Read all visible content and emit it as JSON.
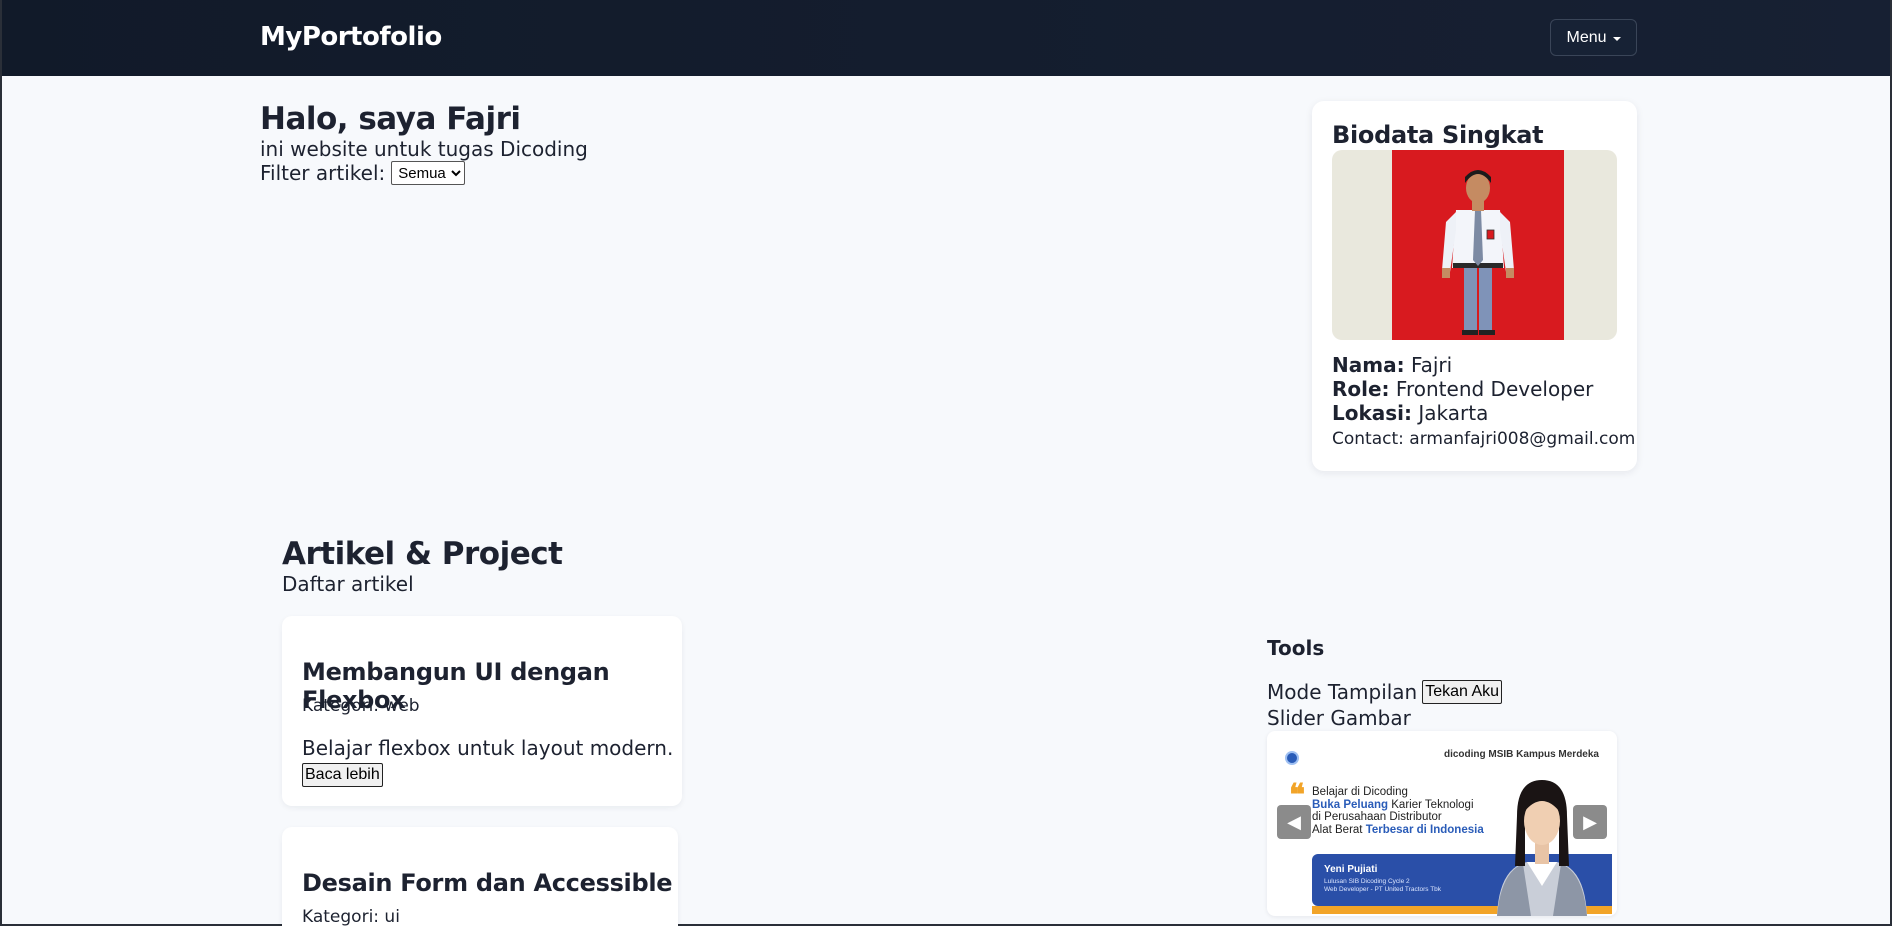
{
  "navbar": {
    "brand": "MyPortofolio",
    "menu_label": "Menu"
  },
  "hero": {
    "title": "Halo, saya Fajri",
    "subtitle": "ini website untuk tugas Dicoding",
    "filter_label": "Filter artikel:",
    "filter_selected": "Semua"
  },
  "biodata": {
    "title": "Biodata Singkat",
    "nama_label": "Nama:",
    "nama_value": "Fajri",
    "role_label": "Role:",
    "role_value": "Frontend Developer",
    "lokasi_label": "Lokasi:",
    "lokasi_value": "Jakarta",
    "contact": "Contact: armanfajri008@gmail.com"
  },
  "articles": {
    "title": "Artikel & Project",
    "subtitle": "Daftar artikel",
    "items": [
      {
        "title": "Membangun UI dengan Flexbox",
        "category": "Kategori: web",
        "description": "Belajar flexbox untuk layout modern.",
        "button": "Baca lebih"
      },
      {
        "title": "Desain Form dan Accessible",
        "category": "Kategori: ui"
      }
    ]
  },
  "tools": {
    "title": "Tools",
    "mode_label": "Mode Tampilan",
    "mode_button": "Tekan Aku",
    "slider_label": "Slider Gambar",
    "slide": {
      "brands": "dicoding  MSIB  Kampus Merdeka",
      "quote_mark": "❝",
      "line1": "Belajar di Dicoding",
      "line2_hl": "Buka Peluang",
      "line2_rest": " Karier Teknologi",
      "line3": "di Perusahaan Distributor",
      "line4_pre": "Alat Berat ",
      "line4_hl": "Terbesar di Indonesia",
      "person_name": "Yeni Pujiati",
      "person_desc1": "Lulusan SIB Dicoding Cycle 2",
      "person_desc2": "Web Developer - PT United Tractors Tbk",
      "prev": "◀",
      "next": "▶"
    }
  },
  "colors": {
    "navbar_bg": "#111a29",
    "page_bg": "#f7f9fc",
    "card_bg": "#ffffff",
    "accent_blue": "#2a4fa8",
    "accent_orange": "#f2a428",
    "photo_red": "#d81a1f"
  }
}
